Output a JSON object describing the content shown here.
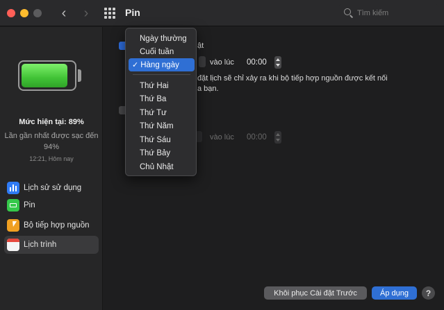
{
  "window": {
    "title": "Pin",
    "search_placeholder": "Tìm kiếm"
  },
  "sidebar": {
    "battery_level_percent": 89,
    "level_text": "Mức hiện tại: 89%",
    "last_charged_text": "Lần gần nhất được sạc đến 94%",
    "timestamp": "12:21, Hôm nay",
    "items": [
      {
        "label": "Lịch sử sử dụng",
        "icon": "bar-chart-icon"
      },
      {
        "label": "Pin",
        "icon": "battery-icon"
      },
      {
        "label": "Bộ tiếp hợp nguồn",
        "icon": "power-adapter-icon"
      },
      {
        "label": "Lịch trình",
        "icon": "calendar-icon",
        "selected": true
      }
    ]
  },
  "schedule": {
    "row1_suffix": "ật",
    "at_label": "vào lúc",
    "time1": "00:00",
    "note_line1": "đặt lịch sẽ chỉ xảy ra khi bộ tiếp hợp nguồn được kết nối",
    "note_line2": "a bạn.",
    "at_label_disabled": "vào lúc",
    "time2": "00:00"
  },
  "dropdown": {
    "options_group1": [
      "Ngày thường",
      "Cuối tuần",
      "Hàng ngày"
    ],
    "options_group2": [
      "Thứ Hai",
      "Thứ Ba",
      "Thứ Tư",
      "Thứ Năm",
      "Thứ Sáu",
      "Thứ Bảy",
      "Chủ Nhật"
    ],
    "selected": "Hàng ngày",
    "checkmark": "✓"
  },
  "footer": {
    "restore_label": "Khôi phục Cài đặt Trước",
    "apply_label": "Áp dụng",
    "help_label": "?"
  },
  "colors": {
    "accent": "#2f6fd4",
    "battery_green": "#41c336",
    "window_bg": "#1e1e1f"
  }
}
